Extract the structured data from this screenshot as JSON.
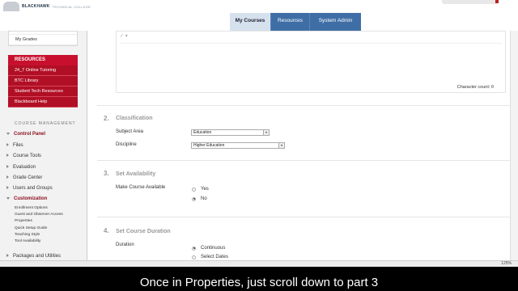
{
  "header": {
    "logo_name": "BLACKHAWK",
    "logo_sub": "TECHNICAL COLLEGE",
    "tabs": [
      {
        "label": "My Courses",
        "active": true
      },
      {
        "label": "Resources",
        "active": false
      },
      {
        "label": "System Admin",
        "active": false
      }
    ]
  },
  "sidebar": {
    "top_items": [
      "My Grades"
    ],
    "resources_title": "RESOURCES",
    "resources": [
      "24_7 Online Tutoring",
      "BTC Library",
      "Student Tech Resources",
      "Blackboard Help"
    ],
    "course_management": "COURSE MANAGEMENT",
    "control_panel": "Control Panel",
    "links": [
      "Files",
      "Course Tools",
      "Evaluation",
      "Grade Center",
      "Users and Groups",
      "Customization"
    ],
    "customization_sub": [
      "Enrollment Options",
      "Guest and Observer Access",
      "Properties",
      "Quick Setup Guide",
      "Teaching Style",
      "Tool Availability"
    ],
    "packages": "Packages and Utilities"
  },
  "main": {
    "character_count": "Character count: 0",
    "step2": {
      "num": "2.",
      "title": "Classification"
    },
    "subject_area_label": "Subject Area",
    "subject_area_value": "Education",
    "discipline_label": "Discipline",
    "discipline_value": "Higher Education",
    "step3": {
      "num": "3.",
      "title": "Set Availability"
    },
    "make_available_label": "Make Course Available",
    "yes_label": "Yes",
    "no_label": "No",
    "step4": {
      "num": "4.",
      "title": "Set Course Duration"
    },
    "duration_label": "Duration",
    "continuous_label": "Continuous",
    "select_dates_label": "Select Dates"
  },
  "status": {
    "zoom": "125%"
  },
  "caption": "Once in Properties, just scroll down to part 3"
}
